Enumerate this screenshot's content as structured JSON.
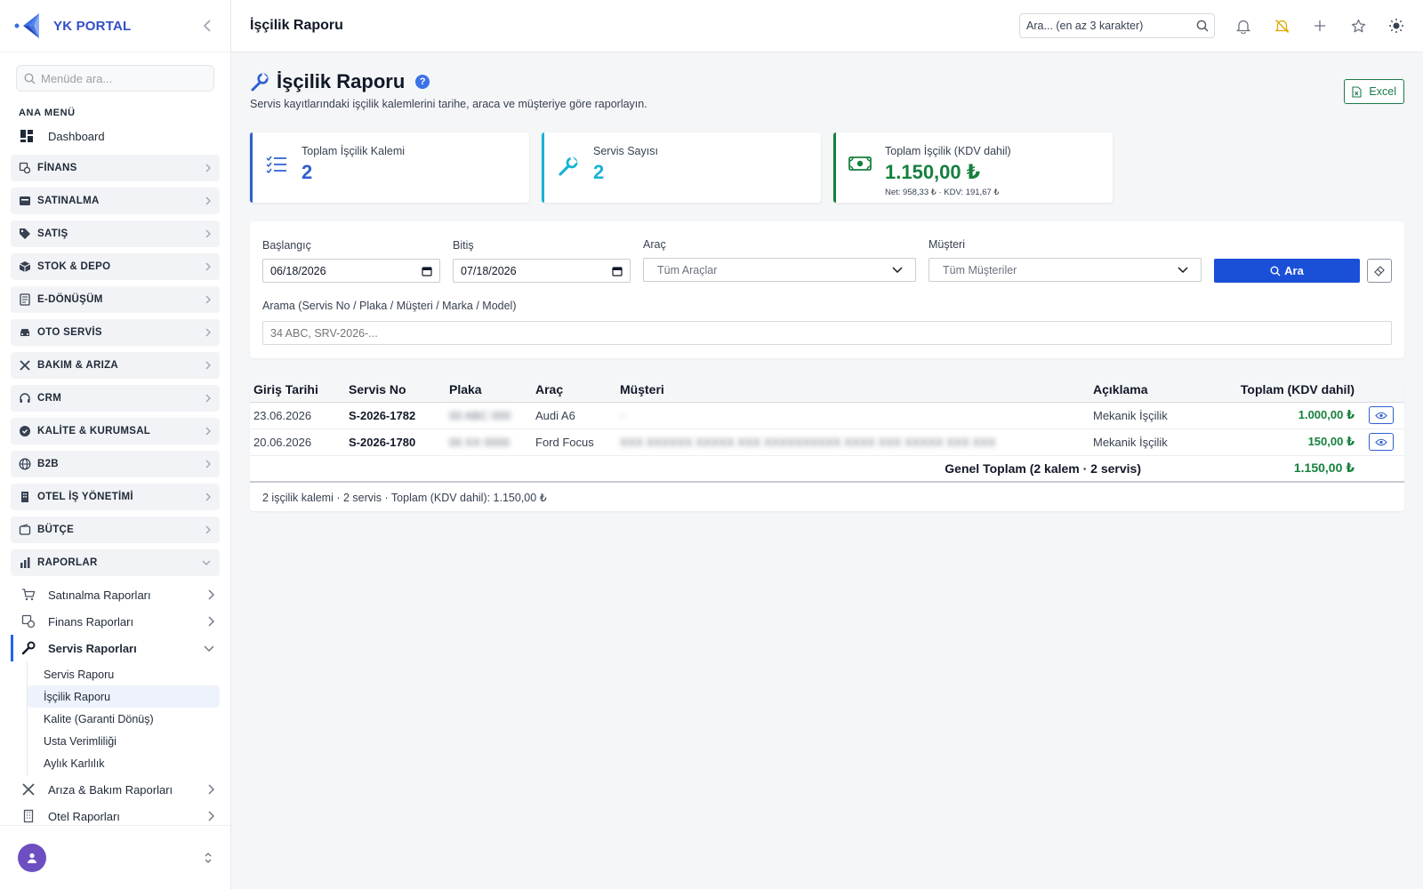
{
  "brand": {
    "name": "YK PORTAL"
  },
  "sidebar": {
    "search_placeholder": "Menüde ara...",
    "section": "ANA MENÜ",
    "dashboard": "Dashboard",
    "groups": [
      {
        "label": "FİNANS",
        "icon": "finance-icon"
      },
      {
        "label": "SATINALMA",
        "icon": "purchase-icon"
      },
      {
        "label": "SATIŞ",
        "icon": "tag-icon"
      },
      {
        "label": "STOK & DEPO",
        "icon": "box-icon"
      },
      {
        "label": "E-DÖNÜŞÜM",
        "icon": "document-icon"
      },
      {
        "label": "OTO SERVİS",
        "icon": "car-icon"
      },
      {
        "label": "BAKIM & ARIZA",
        "icon": "tools-icon"
      },
      {
        "label": "CRM",
        "icon": "headset-icon"
      },
      {
        "label": "KALİTE & KURUMSAL",
        "icon": "badge-icon"
      },
      {
        "label": "B2B",
        "icon": "globe-icon"
      },
      {
        "label": "OTEL İŞ YÖNETİMİ",
        "icon": "building-icon"
      },
      {
        "label": "BÜTÇE",
        "icon": "wallet-icon"
      },
      {
        "label": "RAPORLAR",
        "icon": "chart-icon"
      }
    ],
    "reports": {
      "purchase": "Satınalma Raporları",
      "finance": "Finans Raporları",
      "service": "Servis Raporları",
      "service_leaves": [
        "Servis Raporu",
        "İşçilik Raporu",
        "Kalite (Garanti Dönüş)",
        "Usta Verimliliği",
        "Aylık Karlılık"
      ],
      "fault": "Arıza & Bakım Raporları",
      "hotel": "Otel Raporları"
    }
  },
  "topbar": {
    "title": "İşçilik Raporu",
    "search_placeholder": "Ara... (en az 3 karakter)"
  },
  "page": {
    "title": "İşçilik Raporu",
    "help": "?",
    "subtitle": "Servis kayıtlarındaki işçilik kalemlerini tarihe, araca ve müşteriye göre raporlayın.",
    "excel": "Excel"
  },
  "kpis": [
    {
      "label": "Toplam İşçilik Kalemi",
      "value": "2",
      "color": "#2f5fd0"
    },
    {
      "label": "Servis Sayısı",
      "value": "2",
      "color": "#17b3d4"
    },
    {
      "label": "Toplam İşçilik (KDV dahil)",
      "value": "1.150,00 ₺",
      "note": "Net: 958,33 ₺ · KDV: 191,67 ₺",
      "color": "#15803d"
    }
  ],
  "filters": {
    "start_label": "Başlangıç",
    "start_value": "06/18/2026",
    "end_label": "Bitiş",
    "end_value": "07/18/2026",
    "vehicle_label": "Araç",
    "vehicle_value": "Tüm Araçlar",
    "customer_label": "Müşteri",
    "customer_value": "Tüm Müşteriler",
    "search_button": "Ara",
    "query_label": "Arama (Servis No / Plaka / Müşteri / Marka / Model)",
    "query_placeholder": "34 ABC, SRV-2026-..."
  },
  "table": {
    "headers": [
      "Giriş Tarihi",
      "Servis No",
      "Plaka",
      "Araç",
      "Müşteri",
      "Açıklama",
      "Toplam (KDV dahil)"
    ],
    "rows": [
      {
        "date": "23.06.2026",
        "no": "S-2026-1782",
        "plate": "00 ABC 000",
        "vehicle": "Audi A6",
        "customer": "-",
        "desc": "Mekanik İşçilik",
        "total": "1.000,00 ₺"
      },
      {
        "date": "20.06.2026",
        "no": "S-2026-1780",
        "plate": "00 XX 0000",
        "vehicle": "Ford Focus",
        "customer": "XXX XXXXXX XXXXX XXX XXXXXXXXXX XXXX XXX XXXXX XXX XXX",
        "desc": "Mekanik İşçilik",
        "total": "150,00 ₺"
      }
    ],
    "total_label": "Genel Toplam (2 kalem · 2 servis)",
    "total_value": "1.150,00 ₺",
    "footer": "2 işçilik kalemi · 2 servis · Toplam (KDV dahil): 1.150,00 ₺"
  }
}
